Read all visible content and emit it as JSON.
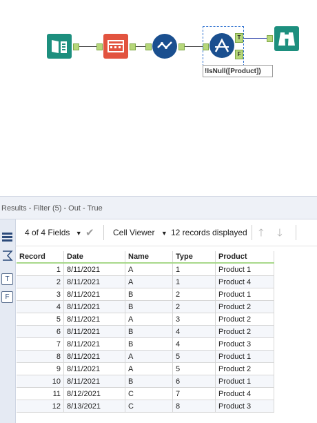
{
  "canvas": {
    "annotation": "!IsNull([Product])",
    "filter_true_label": "T",
    "filter_false_label": "F"
  },
  "results": {
    "title": "Results - Filter (5) - Out - True",
    "fields_label": "4 of 4 Fields",
    "viewer_label": "Cell Viewer",
    "records_label": "12 records displayed",
    "side_tab_true": "T",
    "side_tab_false": "F",
    "columns": [
      "Record",
      "Date",
      "Name",
      "Type",
      "Product"
    ],
    "rows": [
      [
        "1",
        "8/11/2021",
        "A",
        "1",
        "Product 1"
      ],
      [
        "2",
        "8/11/2021",
        "A",
        "1",
        "Product 4"
      ],
      [
        "3",
        "8/11/2021",
        "B",
        "2",
        "Product 1"
      ],
      [
        "4",
        "8/11/2021",
        "B",
        "2",
        "Product 2"
      ],
      [
        "5",
        "8/11/2021",
        "A",
        "3",
        "Product 2"
      ],
      [
        "6",
        "8/11/2021",
        "B",
        "4",
        "Product 2"
      ],
      [
        "7",
        "8/11/2021",
        "B",
        "4",
        "Product 3"
      ],
      [
        "8",
        "8/11/2021",
        "A",
        "5",
        "Product 1"
      ],
      [
        "9",
        "8/11/2021",
        "A",
        "5",
        "Product 2"
      ],
      [
        "10",
        "8/11/2021",
        "B",
        "6",
        "Product 1"
      ],
      [
        "11",
        "8/12/2021",
        "C",
        "7",
        "Product 4"
      ],
      [
        "12",
        "8/13/2021",
        "C",
        "8",
        "Product 3"
      ]
    ]
  }
}
